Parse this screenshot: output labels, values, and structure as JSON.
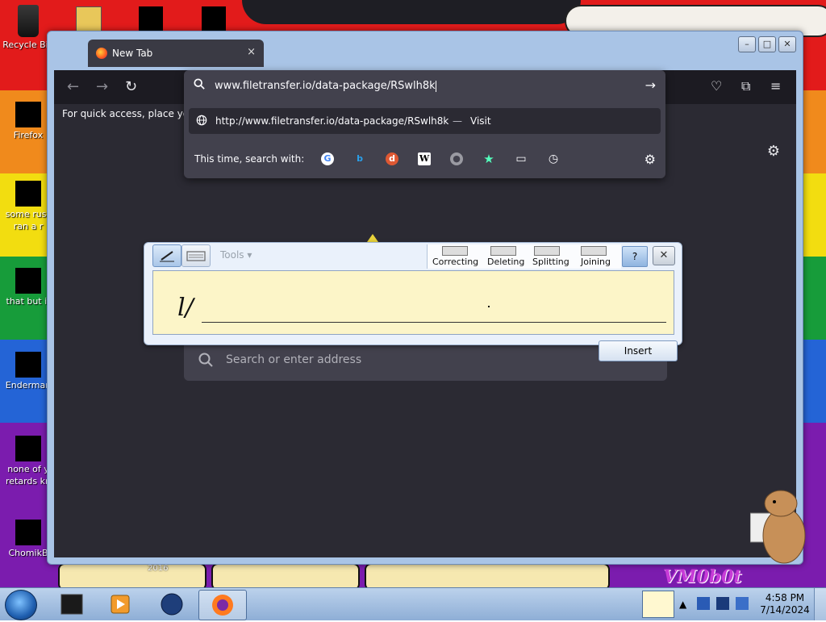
{
  "desktop": {
    "icons": [
      {
        "label": "Recycle Bin",
        "icon": "recycle-bin-icon"
      },
      {
        "label": "Firefox",
        "icon": "firefox-shortcut-icon"
      },
      {
        "label": "some russ",
        "label2": "ran a r",
        "icon": "file-icon"
      },
      {
        "label": "that but it",
        "icon": "folder-icon"
      },
      {
        "label": "Enderman",
        "icon": "app-icon"
      },
      {
        "label": "none of y",
        "label2": "retards kn",
        "icon": "app-icon"
      },
      {
        "label": "ChomikB",
        "icon": "hamster-icon"
      }
    ],
    "wallpaper_year": "2016",
    "wallpaper_signature": "VM0b0t"
  },
  "browser": {
    "tab_title": "New Tab",
    "tab_close": "×",
    "toolbar": {
      "back": "←",
      "forward": "→",
      "reload": "↻"
    },
    "bookmarks_text": "For quick access, place your b",
    "url": {
      "value": "www.filetransfer.io/data-package/RSwlh8k",
      "go": "→",
      "suggestion_url": "http://www.filetransfer.io/data-package/RSwlh8k",
      "suggestion_sep": "—",
      "suggestion_action": "Visit",
      "search_with_label": "This time, search with:",
      "engines": [
        "google",
        "bing",
        "duckduckgo",
        "wikipedia",
        "search",
        "bookmarks",
        "tabs",
        "history"
      ]
    },
    "newtab_search_placeholder": "Search or enter address"
  },
  "tip": {
    "tools_label": "Tools",
    "gestures": [
      "Correcting",
      "Deleting",
      "Splitting",
      "Joining"
    ],
    "close": "✕",
    "ink_text": "l/",
    "insert_label": "Insert"
  },
  "taskbar": {
    "time": "4:58 PM",
    "date": "7/14/2024"
  },
  "colors": {
    "browser_bg": "#2b2a33",
    "urlbar_bg": "#42414d",
    "ink_bg": "#fcf5c8",
    "taskbar": "#a7c1e2"
  }
}
